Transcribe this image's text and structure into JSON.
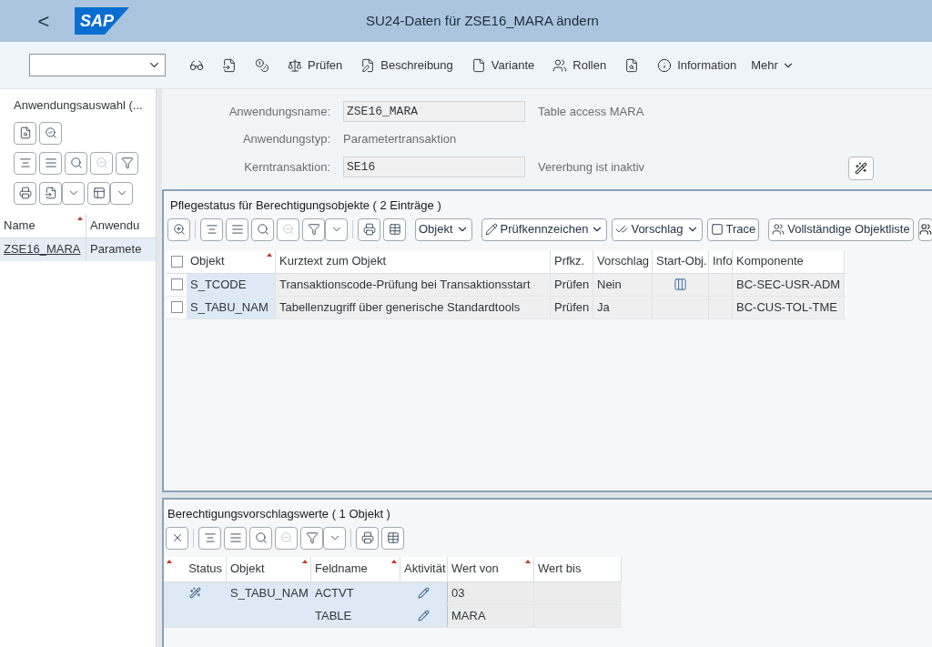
{
  "header": {
    "back": "<",
    "logo": "SAP",
    "title": "SU24-Daten für ZSE16_MARA ändern"
  },
  "toolbar": [
    {
      "kind": "glasses"
    },
    {
      "kind": "export"
    },
    {
      "kind": "coins"
    },
    {
      "kind": "scale",
      "label": "Prüfen"
    },
    {
      "kind": "edit",
      "label": "Beschreibung"
    },
    {
      "kind": "file",
      "label": "Variante"
    },
    {
      "kind": "roles",
      "label": "Rollen"
    },
    {
      "kind": "report"
    },
    {
      "kind": "info",
      "label": "Information"
    },
    {
      "kind": "more",
      "label": "Mehr"
    }
  ],
  "sidebar": {
    "title": "Anwendungsauswahl (...",
    "columns": [
      {
        "label": "Name",
        "sorted": true
      },
      {
        "label": "Anwendu",
        "sorted": false
      }
    ],
    "rows": [
      {
        "cells": [
          "ZSE16_MARA",
          "Paramete"
        ],
        "selected": true
      }
    ]
  },
  "form": {
    "fields": [
      {
        "label": "Anwendungsname:",
        "value": "ZSE16_MARA",
        "note": "Table access MARA",
        "kind": "input"
      },
      {
        "label": "Anwendungstyp:",
        "value": "Parametertransaktion",
        "kind": "text"
      },
      {
        "label": "Kerntransaktion:",
        "value": "SE16",
        "note": "Vererbung ist inaktiv",
        "kind": "input"
      }
    ]
  },
  "objects_panel": {
    "title": "Pflegestatus für Berechtigungsobjekte ( 2 Einträge )",
    "select_all_checked": false,
    "buttons": [
      {
        "label": "Objekt",
        "kind": "dropdown"
      },
      {
        "label": "Prüfkennzeichen",
        "kind": "edit-dropdown"
      },
      {
        "label": "Vorschlag",
        "kind": "check-dropdown"
      },
      {
        "label": "Trace",
        "kind": "file"
      },
      {
        "label": "Vollständige Objektliste",
        "kind": "roles"
      }
    ],
    "columns": [
      {
        "label": "Objekt",
        "sorted": true
      },
      {
        "label": "Kurztext zum Objekt",
        "sorted": false
      },
      {
        "label": "Prfkz.",
        "sorted": false
      },
      {
        "label": "Vorschlag",
        "sorted": false
      },
      {
        "label": "Start-Obj.",
        "sorted": false
      },
      {
        "label": "Info",
        "sorted": false
      },
      {
        "label": "Komponente",
        "sorted": false
      }
    ],
    "rows": [
      {
        "checked": false,
        "objekt": "S_TCODE",
        "kurztext": "Transaktionscode-Prüfung bei Transaktionsstart",
        "prfkz": "Prüfen",
        "vorschlag": "Nein",
        "start_object": true,
        "komponente": "BC-SEC-USR-ADM"
      },
      {
        "checked": false,
        "objekt": "S_TABU_NAM",
        "kurztext": "Tabellenzugriff über generische Standardtools",
        "prfkz": "Prüfen",
        "vorschlag": "Ja",
        "start_object": false,
        "komponente": "BC-CUS-TOL-TME"
      }
    ]
  },
  "values_panel": {
    "title": "Berechtigungsvorschlagswerte ( 1 Objekt )",
    "columns": [
      {
        "label": "Status",
        "sorted": true
      },
      {
        "label": "Objekt",
        "sorted": true
      },
      {
        "label": "Feldname",
        "sorted": true
      },
      {
        "label": "Aktivität",
        "sorted": false
      },
      {
        "label": "Wert von",
        "sorted": true
      },
      {
        "label": "Wert bis",
        "sorted": false
      }
    ],
    "rows": [
      {
        "status_icon": true,
        "objekt": "S_TABU_NAM",
        "feldname": "ACTVT",
        "editable": true,
        "wert_von": "03"
      },
      {
        "status_icon": false,
        "feldname": "TABLE",
        "editable": true,
        "wert_von": "MARA"
      }
    ]
  }
}
